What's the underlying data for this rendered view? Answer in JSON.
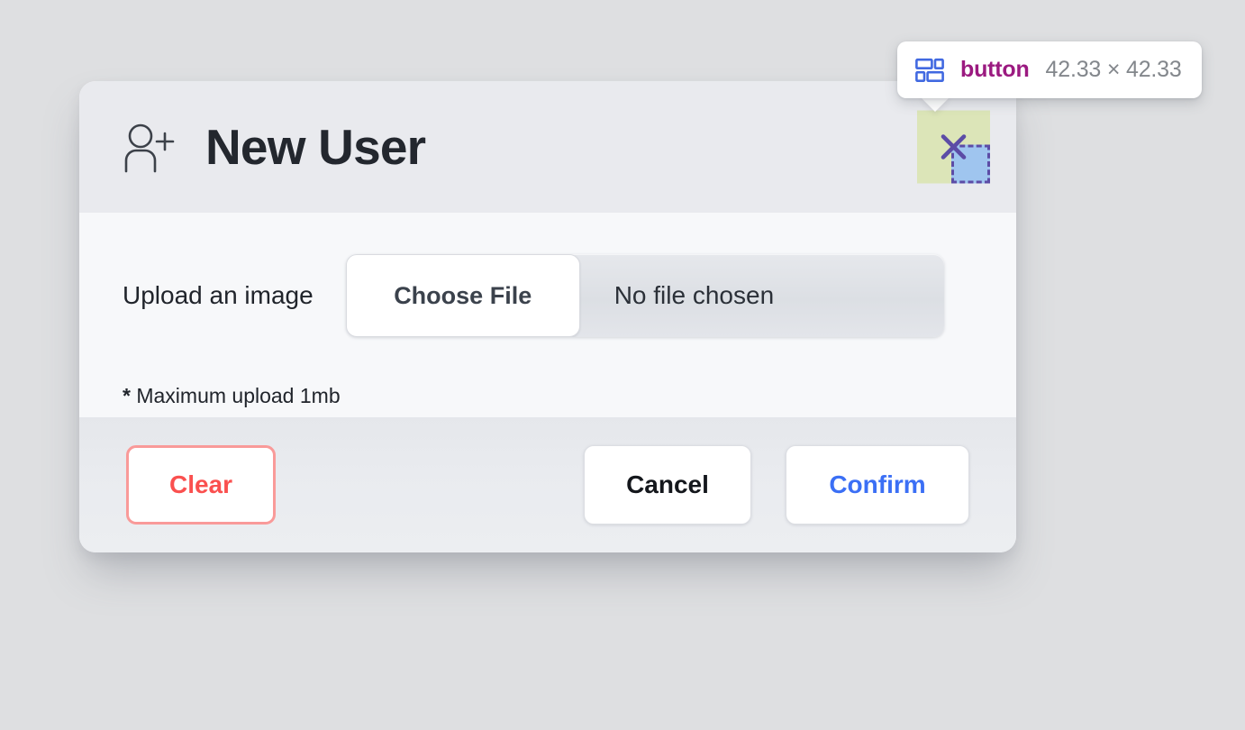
{
  "page": {
    "background_color": "#dedfe1"
  },
  "modal": {
    "header": {
      "icon": "user-plus-icon",
      "title": "New User",
      "close_button": {
        "icon": "close-x-icon",
        "label": ""
      }
    },
    "body": {
      "upload_label": "Upload an image",
      "file_input": {
        "choose_button_label": "Choose File",
        "file_name_value": "No file chosen",
        "placeholder": "No file chosen"
      },
      "hint_star": "*",
      "hint_text": "Maximum upload 1mb"
    },
    "footer": {
      "clear_label": "Clear",
      "cancel_label": "Cancel",
      "confirm_label": "Confirm"
    },
    "colors": {
      "header_bg": "#e9eaee",
      "body_bg": "#f7f8fa",
      "footer_bg": "#eaebef",
      "clear_text": "#fa504f",
      "clear_border": "#f99a99",
      "confirm_text": "#3b6ff5",
      "cancel_text": "#14171c"
    }
  },
  "inspector": {
    "tooltip": {
      "icon": "layout-blocks-icon",
      "icon_color": "#4169e1",
      "tag_name": "button",
      "tag_color": "#9b1a80",
      "dimensions": "42.33 × 42.33",
      "dimensions_color": "#83878c"
    },
    "highlight": {
      "content_color": "#9fc5ef",
      "padding_color": "#dce5b8",
      "border_color": "#5c4ca6",
      "target": "close-button"
    }
  }
}
